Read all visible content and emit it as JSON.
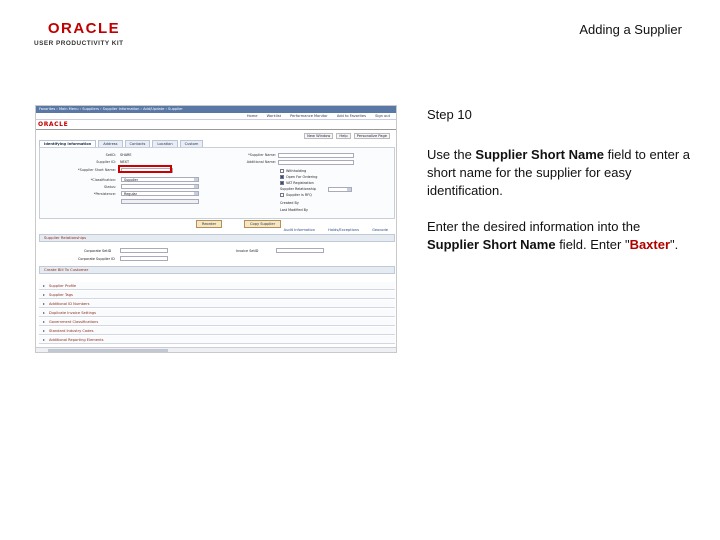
{
  "header": {
    "logo_main": "ORACLE",
    "logo_sub": "USER PRODUCTIVITY KIT",
    "slide_title": "Adding a Supplier"
  },
  "panel": {
    "step": "Step 10",
    "p1_before": "Use the ",
    "p1_bold": "Supplier Short Name",
    "p1_after": " field to enter a short name for the supplier for easy identification.",
    "p2_before": "Enter the desired information into the ",
    "p2_bold": "Supplier Short Name",
    "p2_mid": " field. Enter \"",
    "p2_value": "Baxter",
    "p2_end": "\"."
  },
  "screenshot": {
    "breadcrumb": "Favorites  ›  Main Menu  ›  Suppliers  ›  Supplier Information  ›  Add/Update  ›  Supplier",
    "nav": [
      "Home",
      "Worklist",
      "Performance Monitor",
      "Add to Favorites",
      "Sign out"
    ],
    "brand": "ORACLE",
    "page_links": [
      "New Window",
      "Help",
      "Personalize Page"
    ],
    "tabs": [
      "Identifying Information",
      "Address",
      "Contacts",
      "Location",
      "Custom"
    ],
    "form": {
      "setid_label": "SetID:",
      "setid_value": "SHARE",
      "supplier_id_label": "Supplier ID:",
      "supplier_id_value": "NEXT",
      "short_name_label": "*Supplier Short Name:",
      "classification_label": "*Classification:",
      "classification_value": "Supplier",
      "status_label": "Status:",
      "persistence_label": "*Persistence:",
      "persistence_value": "Regular",
      "supplier_name_label": "*Supplier Name:",
      "additional_name_label": "Additional Name:",
      "withholding": "Withholding",
      "open_for_ordering": "Open For Ordering",
      "vat_registration": "VAT Registration",
      "supplier_relationship": "Supplier Relationship",
      "rfq_label": "Supplier is RFQ",
      "created_label": "Created By",
      "last_modified": "Last Modified By"
    },
    "buttons": [
      "Reorder",
      "Copy Supplier"
    ],
    "links": [
      "Audit Information",
      "Holds/Exceptions",
      "Geocode"
    ],
    "supplier_relationships": "Supplier Relationships",
    "corporate_setid": "Corporate SetID",
    "corporate_supplier": "Corporate Supplier ID",
    "invoice_setid": "Invoice SetID",
    "bill_to": "Create Bill To Customer",
    "sections": [
      "Supplier Profile",
      "Supplier Tags",
      "Additional ID Numbers",
      "Duplicate Invoice Settings",
      "Government Classifications",
      "Standard Industry Codes",
      "Additional Reporting Elements"
    ]
  }
}
